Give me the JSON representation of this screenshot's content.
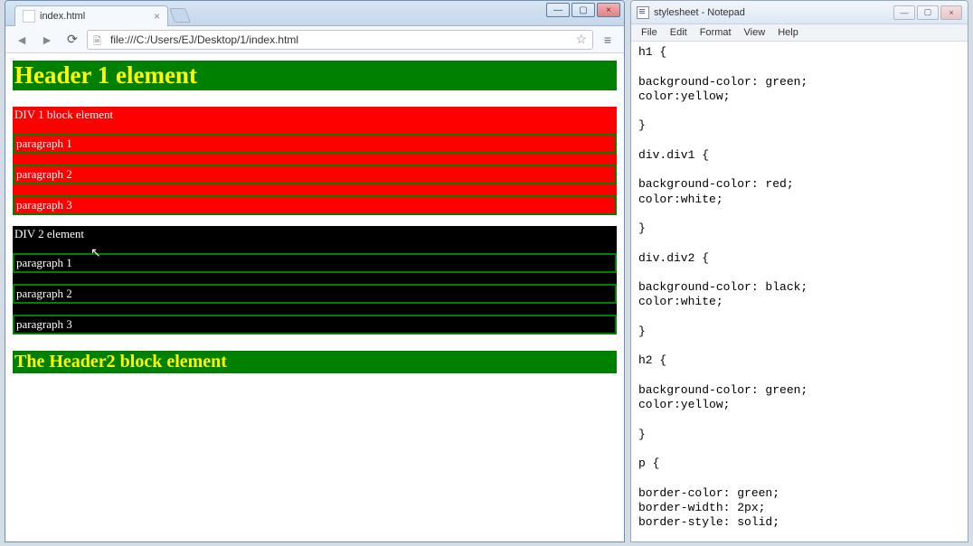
{
  "chrome": {
    "tabTitle": "index.html",
    "url": "file:///C:/Users/EJ/Desktop/1/index.html",
    "controls": {
      "min": "—",
      "max": "▢",
      "close": "×"
    }
  },
  "page": {
    "h1": "Header 1 element",
    "div1": {
      "label": "DIV 1 block element",
      "p": [
        "paragraph 1",
        "paragraph 2",
        "paragraph 3"
      ]
    },
    "div2": {
      "label": "DIV 2 element",
      "p": [
        "paragraph 1",
        "paragraph 2",
        "paragraph 3"
      ]
    },
    "h2": "The Header2 block element"
  },
  "notepad": {
    "title": "stylesheet - Notepad",
    "menu": [
      "File",
      "Edit",
      "Format",
      "View",
      "Help"
    ],
    "controls": {
      "min": "—",
      "max": "▢",
      "close": "×"
    },
    "content": "h1 {\n\nbackground-color: green;\ncolor:yellow;\n\n}\n\ndiv.div1 {\n\nbackground-color: red;\ncolor:white;\n\n}\n\ndiv.div2 {\n\nbackground-color: black;\ncolor:white;\n\n}\n\nh2 {\n\nbackground-color: green;\ncolor:yellow;\n\n}\n\np {\n\nborder-color: green;\nborder-width: 2px;\nborder-style: solid;\n\n}"
  }
}
